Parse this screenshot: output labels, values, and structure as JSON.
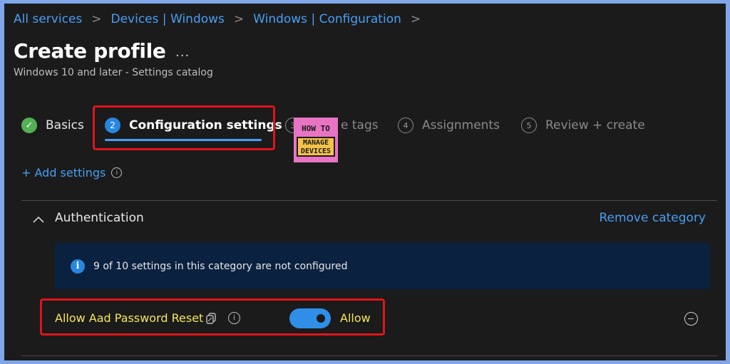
{
  "breadcrumb": {
    "items": [
      "All services",
      "Devices | Windows",
      "Windows | Configuration"
    ],
    "separator": ">"
  },
  "header": {
    "title": "Create profile",
    "more_icon": "...",
    "subtitle": "Windows 10 and later - Settings catalog"
  },
  "steps": [
    {
      "marker": "✓",
      "label": "Basics",
      "state": "complete"
    },
    {
      "marker": "2",
      "label": "Configuration settings",
      "state": "active"
    },
    {
      "marker": "3",
      "label": "Scope tags",
      "visible_label": "e tags",
      "state": "pending"
    },
    {
      "marker": "4",
      "label": "Assignments",
      "state": "pending"
    },
    {
      "marker": "5",
      "label": "Review + create",
      "state": "pending"
    }
  ],
  "watermark": {
    "line1": "HOW TO",
    "line2": "MANAGE",
    "line3": "DEVICES"
  },
  "add_settings": {
    "label": "+ Add settings",
    "info_icon": "i"
  },
  "category": {
    "title": "Authentication",
    "remove_label": "Remove category",
    "banner": {
      "icon": "i",
      "text": "9 of 10 settings in this category are not configured"
    }
  },
  "setting": {
    "label": "Allow Aad Password Reset",
    "info_icon": "i",
    "toggle_on": true,
    "value_label": "Allow"
  },
  "colors": {
    "background": "#1b1b1b",
    "link": "#479ef5",
    "accent": "#2886de",
    "success": "#54b054",
    "highlight_border": "#e0141b",
    "highlight_text": "#f5e65c",
    "banner_bg": "#0a2140",
    "frame_border": "#7fa6e8"
  },
  "icons": [
    "chevron-right-icon",
    "more-icon",
    "check-icon",
    "info-icon",
    "chevron-up-icon",
    "copy-icon",
    "toggle-icon",
    "remove-circle-icon"
  ]
}
